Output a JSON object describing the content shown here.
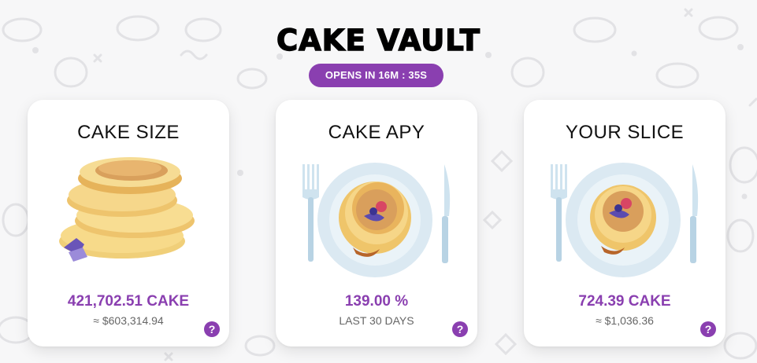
{
  "header": {
    "title": "CAKE VAULT",
    "countdown": "OPENS IN 16M : 35S"
  },
  "colors": {
    "accent": "#8a3fb0",
    "background": "#f7f7f8",
    "card": "#ffffff"
  },
  "cards": [
    {
      "title": "CAKE SIZE",
      "value": "421,702.51 CAKE",
      "sub": "≈ $603,314.94",
      "illustration": "pancake-stack",
      "help_icon": "help-icon",
      "help_label": "?"
    },
    {
      "title": "CAKE APY",
      "value": "139.00 %",
      "sub": "LAST 30 DAYS",
      "illustration": "pancake-plate-with-fork-knife",
      "help_icon": "help-icon",
      "help_label": "?"
    },
    {
      "title": "YOUR SLICE",
      "value": "724.39 CAKE",
      "sub": "≈ $1,036.36",
      "illustration": "pancake-slice-plate-with-fork-knife",
      "help_icon": "help-icon",
      "help_label": "?"
    }
  ]
}
